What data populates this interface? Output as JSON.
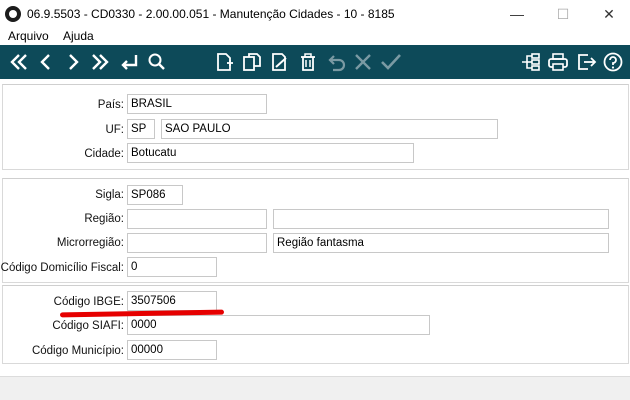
{
  "window": {
    "title": "06.9.5503 - CD0330 - 2.00.00.051 - Manutenção Cidades - 10 - 8185",
    "minimize_glyph": "—",
    "maximize_glyph": "☐",
    "close_glyph": "✕"
  },
  "menu": {
    "items": [
      "Arquivo",
      "Ajuda"
    ]
  },
  "toolbar": {
    "icons": [
      "first-icon",
      "previous-icon",
      "next-icon",
      "last-icon",
      "go-to-icon",
      "search-icon",
      "new-icon",
      "copy-icon",
      "edit-icon",
      "delete-icon",
      "undo-icon",
      "cancel-icon",
      "confirm-icon",
      "tree-icon",
      "print-icon",
      "exit-icon",
      "help-icon"
    ],
    "color": "#0d4a59"
  },
  "location": {
    "pais_label": "País:",
    "pais_value": "BRASIL",
    "uf_label": "UF:",
    "uf_code": "SP",
    "uf_name": "SAO PAULO",
    "cidade_label": "Cidade:",
    "cidade_value": "Botucatu"
  },
  "details": {
    "sigla_label": "Sigla:",
    "sigla_value": "SP086",
    "regiao_label": "Região:",
    "regiao_code": "",
    "regiao_desc": "",
    "microrregiao_label": "Microrregião:",
    "microrregiao_code": "",
    "microrregiao_desc": "Região fantasma",
    "cod_domicilio_label": "Código Domicílio Fiscal:",
    "cod_domicilio_value": "0"
  },
  "codes": {
    "ibge_label": "Código IBGE:",
    "ibge_value": "3507506",
    "siafi_label": "Código SIAFI:",
    "siafi_value": "0000",
    "municipio_label": "Código Município:",
    "municipio_value": "00000"
  },
  "annotation": {
    "underline_color": "#e60000"
  }
}
